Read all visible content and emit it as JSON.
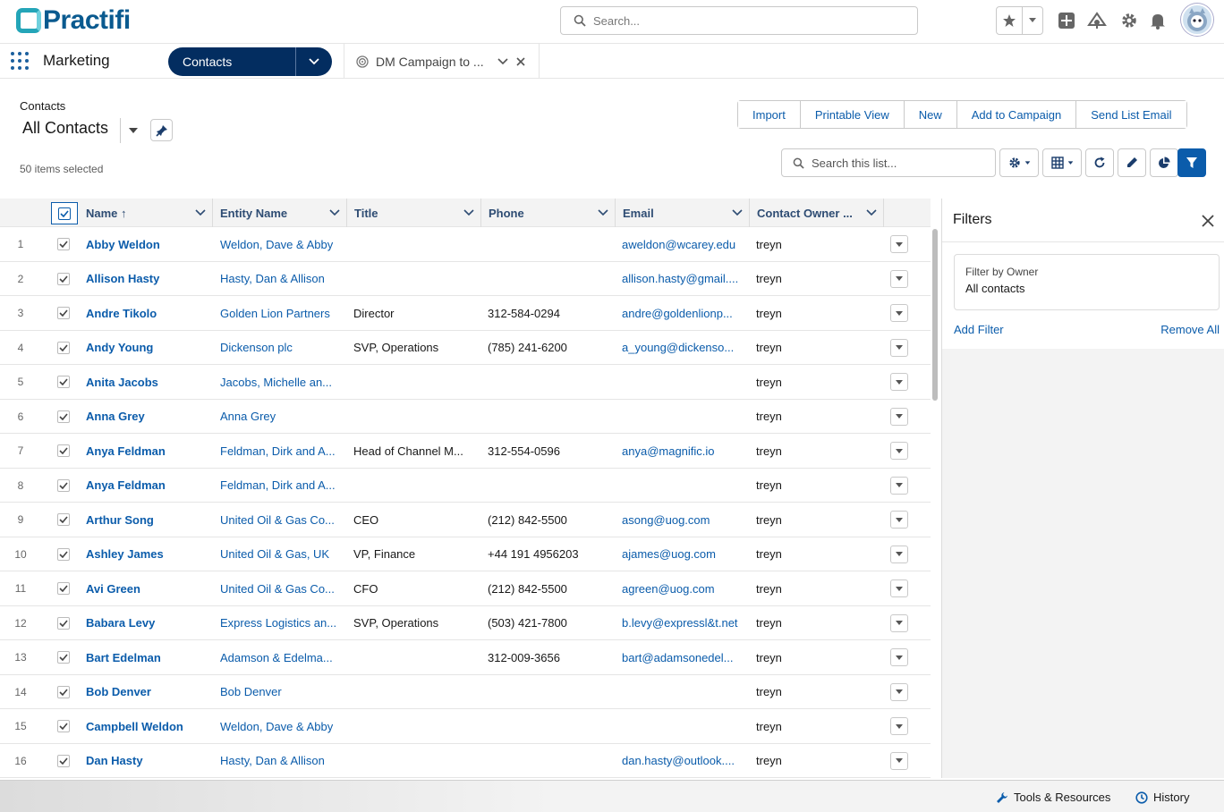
{
  "brand": {
    "name": "Practifi",
    "accent": "#24a5b8",
    "dark": "#0a5a8f"
  },
  "header": {
    "search_placeholder": "Search..."
  },
  "nav": {
    "app_name": "Marketing",
    "active_tab": "Contacts",
    "second_tab": "DM Campaign to ..."
  },
  "list": {
    "breadcrumb": "Contacts",
    "view_name": "All Contacts",
    "selected_count": "50 items selected",
    "search_placeholder": "Search this list...",
    "actions": [
      "Import",
      "Printable View",
      "New",
      "Add to Campaign",
      "Send List Email"
    ]
  },
  "table": {
    "columns": [
      "Name",
      "Entity Name",
      "Title",
      "Phone",
      "Email",
      "Contact Owner ..."
    ],
    "sort_indicator": "↑",
    "rows": [
      {
        "num": "1",
        "name": "Abby Weldon",
        "entity": "Weldon, Dave & Abby",
        "title": "",
        "phone": "",
        "email": "aweldon@wcarey.edu",
        "owner": "treyn"
      },
      {
        "num": "2",
        "name": "Allison Hasty",
        "entity": "Hasty, Dan & Allison",
        "title": "",
        "phone": "",
        "email": "allison.hasty@gmail....",
        "owner": "treyn"
      },
      {
        "num": "3",
        "name": "Andre Tikolo",
        "entity": "Golden Lion Partners",
        "title": "Director",
        "phone": "312-584-0294",
        "email": "andre@goldenlionp...",
        "owner": "treyn"
      },
      {
        "num": "4",
        "name": "Andy Young",
        "entity": "Dickenson plc",
        "title": "SVP, Operations",
        "phone": "(785) 241-6200",
        "email": "a_young@dickenso...",
        "owner": "treyn"
      },
      {
        "num": "5",
        "name": "Anita Jacobs",
        "entity": "Jacobs, Michelle an...",
        "title": "",
        "phone": "",
        "email": "",
        "owner": "treyn"
      },
      {
        "num": "6",
        "name": "Anna Grey",
        "entity": "Anna Grey",
        "title": "",
        "phone": "",
        "email": "",
        "owner": "treyn"
      },
      {
        "num": "7",
        "name": "Anya Feldman",
        "entity": "Feldman, Dirk and A...",
        "title": "Head of Channel M...",
        "phone": "312-554-0596",
        "email": "anya@magnific.io",
        "owner": "treyn"
      },
      {
        "num": "8",
        "name": "Anya Feldman",
        "entity": "Feldman, Dirk and A...",
        "title": "",
        "phone": "",
        "email": "",
        "owner": "treyn"
      },
      {
        "num": "9",
        "name": "Arthur Song",
        "entity": "United Oil & Gas Co...",
        "title": "CEO",
        "phone": "(212) 842-5500",
        "email": "asong@uog.com",
        "owner": "treyn"
      },
      {
        "num": "10",
        "name": "Ashley James",
        "entity": "United Oil & Gas, UK",
        "title": "VP, Finance",
        "phone": "+44 191 4956203",
        "email": "ajames@uog.com",
        "owner": "treyn"
      },
      {
        "num": "11",
        "name": "Avi Green",
        "entity": "United Oil & Gas Co...",
        "title": "CFO",
        "phone": "(212) 842-5500",
        "email": "agreen@uog.com",
        "owner": "treyn"
      },
      {
        "num": "12",
        "name": "Babara Levy",
        "entity": "Express Logistics an...",
        "title": "SVP, Operations",
        "phone": "(503) 421-7800",
        "email": "b.levy@expressl&t.net",
        "owner": "treyn"
      },
      {
        "num": "13",
        "name": "Bart Edelman",
        "entity": "Adamson & Edelma...",
        "title": "",
        "phone": "312-009-3656",
        "email": "bart@adamsonedel...",
        "owner": "treyn"
      },
      {
        "num": "14",
        "name": "Bob Denver",
        "entity": "Bob Denver",
        "title": "",
        "phone": "",
        "email": "",
        "owner": "treyn"
      },
      {
        "num": "15",
        "name": "Campbell Weldon",
        "entity": "Weldon, Dave & Abby",
        "title": "",
        "phone": "",
        "email": "",
        "owner": "treyn"
      },
      {
        "num": "16",
        "name": "Dan Hasty",
        "entity": "Hasty, Dan & Allison",
        "title": "",
        "phone": "",
        "email": "dan.hasty@outlook....",
        "owner": "treyn"
      }
    ]
  },
  "filters": {
    "title": "Filters",
    "card_label": "Filter by Owner",
    "card_value": "All contacts",
    "add_label": "Add Filter",
    "remove_label": "Remove All"
  },
  "utility": {
    "tools_label": "Tools & Resources",
    "history_label": "History"
  },
  "icons": {
    "search": "search-icon",
    "star": "star-icon",
    "add": "plus-icon",
    "trailhead": "trailhead-icon",
    "settings": "gear-icon",
    "notifications": "bell-icon",
    "apps": "waffle-icon",
    "pin": "pin-icon",
    "refresh": "refresh-icon",
    "edit": "pencil-icon",
    "chart": "pie-chart-icon",
    "filter": "filter-icon",
    "close": "close-icon",
    "wrench": "wrench-icon",
    "clock": "clock-icon"
  }
}
